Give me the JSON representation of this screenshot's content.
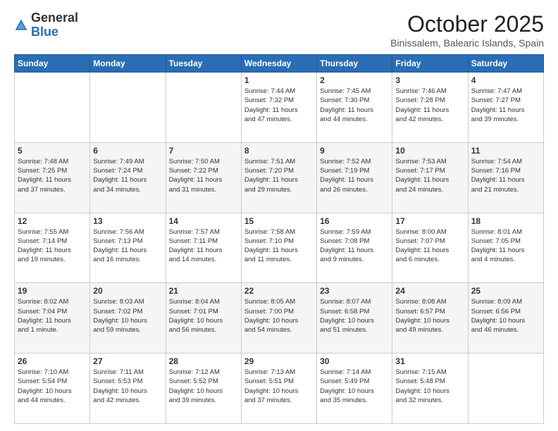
{
  "header": {
    "logo_general": "General",
    "logo_blue": "Blue",
    "month": "October 2025",
    "location": "Binissalem, Balearic Islands, Spain"
  },
  "weekdays": [
    "Sunday",
    "Monday",
    "Tuesday",
    "Wednesday",
    "Thursday",
    "Friday",
    "Saturday"
  ],
  "weeks": [
    [
      {
        "day": "",
        "info": ""
      },
      {
        "day": "",
        "info": ""
      },
      {
        "day": "",
        "info": ""
      },
      {
        "day": "1",
        "info": "Sunrise: 7:44 AM\nSunset: 7:32 PM\nDaylight: 11 hours\nand 47 minutes."
      },
      {
        "day": "2",
        "info": "Sunrise: 7:45 AM\nSunset: 7:30 PM\nDaylight: 11 hours\nand 44 minutes."
      },
      {
        "day": "3",
        "info": "Sunrise: 7:46 AM\nSunset: 7:28 PM\nDaylight: 11 hours\nand 42 minutes."
      },
      {
        "day": "4",
        "info": "Sunrise: 7:47 AM\nSunset: 7:27 PM\nDaylight: 11 hours\nand 39 minutes."
      }
    ],
    [
      {
        "day": "5",
        "info": "Sunrise: 7:48 AM\nSunset: 7:25 PM\nDaylight: 11 hours\nand 37 minutes."
      },
      {
        "day": "6",
        "info": "Sunrise: 7:49 AM\nSunset: 7:24 PM\nDaylight: 11 hours\nand 34 minutes."
      },
      {
        "day": "7",
        "info": "Sunrise: 7:50 AM\nSunset: 7:22 PM\nDaylight: 11 hours\nand 31 minutes."
      },
      {
        "day": "8",
        "info": "Sunrise: 7:51 AM\nSunset: 7:20 PM\nDaylight: 11 hours\nand 29 minutes."
      },
      {
        "day": "9",
        "info": "Sunrise: 7:52 AM\nSunset: 7:19 PM\nDaylight: 11 hours\nand 26 minutes."
      },
      {
        "day": "10",
        "info": "Sunrise: 7:53 AM\nSunset: 7:17 PM\nDaylight: 11 hours\nand 24 minutes."
      },
      {
        "day": "11",
        "info": "Sunrise: 7:54 AM\nSunset: 7:16 PM\nDaylight: 11 hours\nand 21 minutes."
      }
    ],
    [
      {
        "day": "12",
        "info": "Sunrise: 7:55 AM\nSunset: 7:14 PM\nDaylight: 11 hours\nand 19 minutes."
      },
      {
        "day": "13",
        "info": "Sunrise: 7:56 AM\nSunset: 7:13 PM\nDaylight: 11 hours\nand 16 minutes."
      },
      {
        "day": "14",
        "info": "Sunrise: 7:57 AM\nSunset: 7:11 PM\nDaylight: 11 hours\nand 14 minutes."
      },
      {
        "day": "15",
        "info": "Sunrise: 7:58 AM\nSunset: 7:10 PM\nDaylight: 11 hours\nand 11 minutes."
      },
      {
        "day": "16",
        "info": "Sunrise: 7:59 AM\nSunset: 7:08 PM\nDaylight: 11 hours\nand 9 minutes."
      },
      {
        "day": "17",
        "info": "Sunrise: 8:00 AM\nSunset: 7:07 PM\nDaylight: 11 hours\nand 6 minutes."
      },
      {
        "day": "18",
        "info": "Sunrise: 8:01 AM\nSunset: 7:05 PM\nDaylight: 11 hours\nand 4 minutes."
      }
    ],
    [
      {
        "day": "19",
        "info": "Sunrise: 8:02 AM\nSunset: 7:04 PM\nDaylight: 11 hours\nand 1 minute."
      },
      {
        "day": "20",
        "info": "Sunrise: 8:03 AM\nSunset: 7:02 PM\nDaylight: 10 hours\nand 59 minutes."
      },
      {
        "day": "21",
        "info": "Sunrise: 8:04 AM\nSunset: 7:01 PM\nDaylight: 10 hours\nand 56 minutes."
      },
      {
        "day": "22",
        "info": "Sunrise: 8:05 AM\nSunset: 7:00 PM\nDaylight: 10 hours\nand 54 minutes."
      },
      {
        "day": "23",
        "info": "Sunrise: 8:07 AM\nSunset: 6:58 PM\nDaylight: 10 hours\nand 51 minutes."
      },
      {
        "day": "24",
        "info": "Sunrise: 8:08 AM\nSunset: 6:57 PM\nDaylight: 10 hours\nand 49 minutes."
      },
      {
        "day": "25",
        "info": "Sunrise: 8:09 AM\nSunset: 6:56 PM\nDaylight: 10 hours\nand 46 minutes."
      }
    ],
    [
      {
        "day": "26",
        "info": "Sunrise: 7:10 AM\nSunset: 5:54 PM\nDaylight: 10 hours\nand 44 minutes."
      },
      {
        "day": "27",
        "info": "Sunrise: 7:11 AM\nSunset: 5:53 PM\nDaylight: 10 hours\nand 42 minutes."
      },
      {
        "day": "28",
        "info": "Sunrise: 7:12 AM\nSunset: 5:52 PM\nDaylight: 10 hours\nand 39 minutes."
      },
      {
        "day": "29",
        "info": "Sunrise: 7:13 AM\nSunset: 5:51 PM\nDaylight: 10 hours\nand 37 minutes."
      },
      {
        "day": "30",
        "info": "Sunrise: 7:14 AM\nSunset: 5:49 PM\nDaylight: 10 hours\nand 35 minutes."
      },
      {
        "day": "31",
        "info": "Sunrise: 7:15 AM\nSunset: 5:48 PM\nDaylight: 10 hours\nand 32 minutes."
      },
      {
        "day": "",
        "info": ""
      }
    ]
  ]
}
